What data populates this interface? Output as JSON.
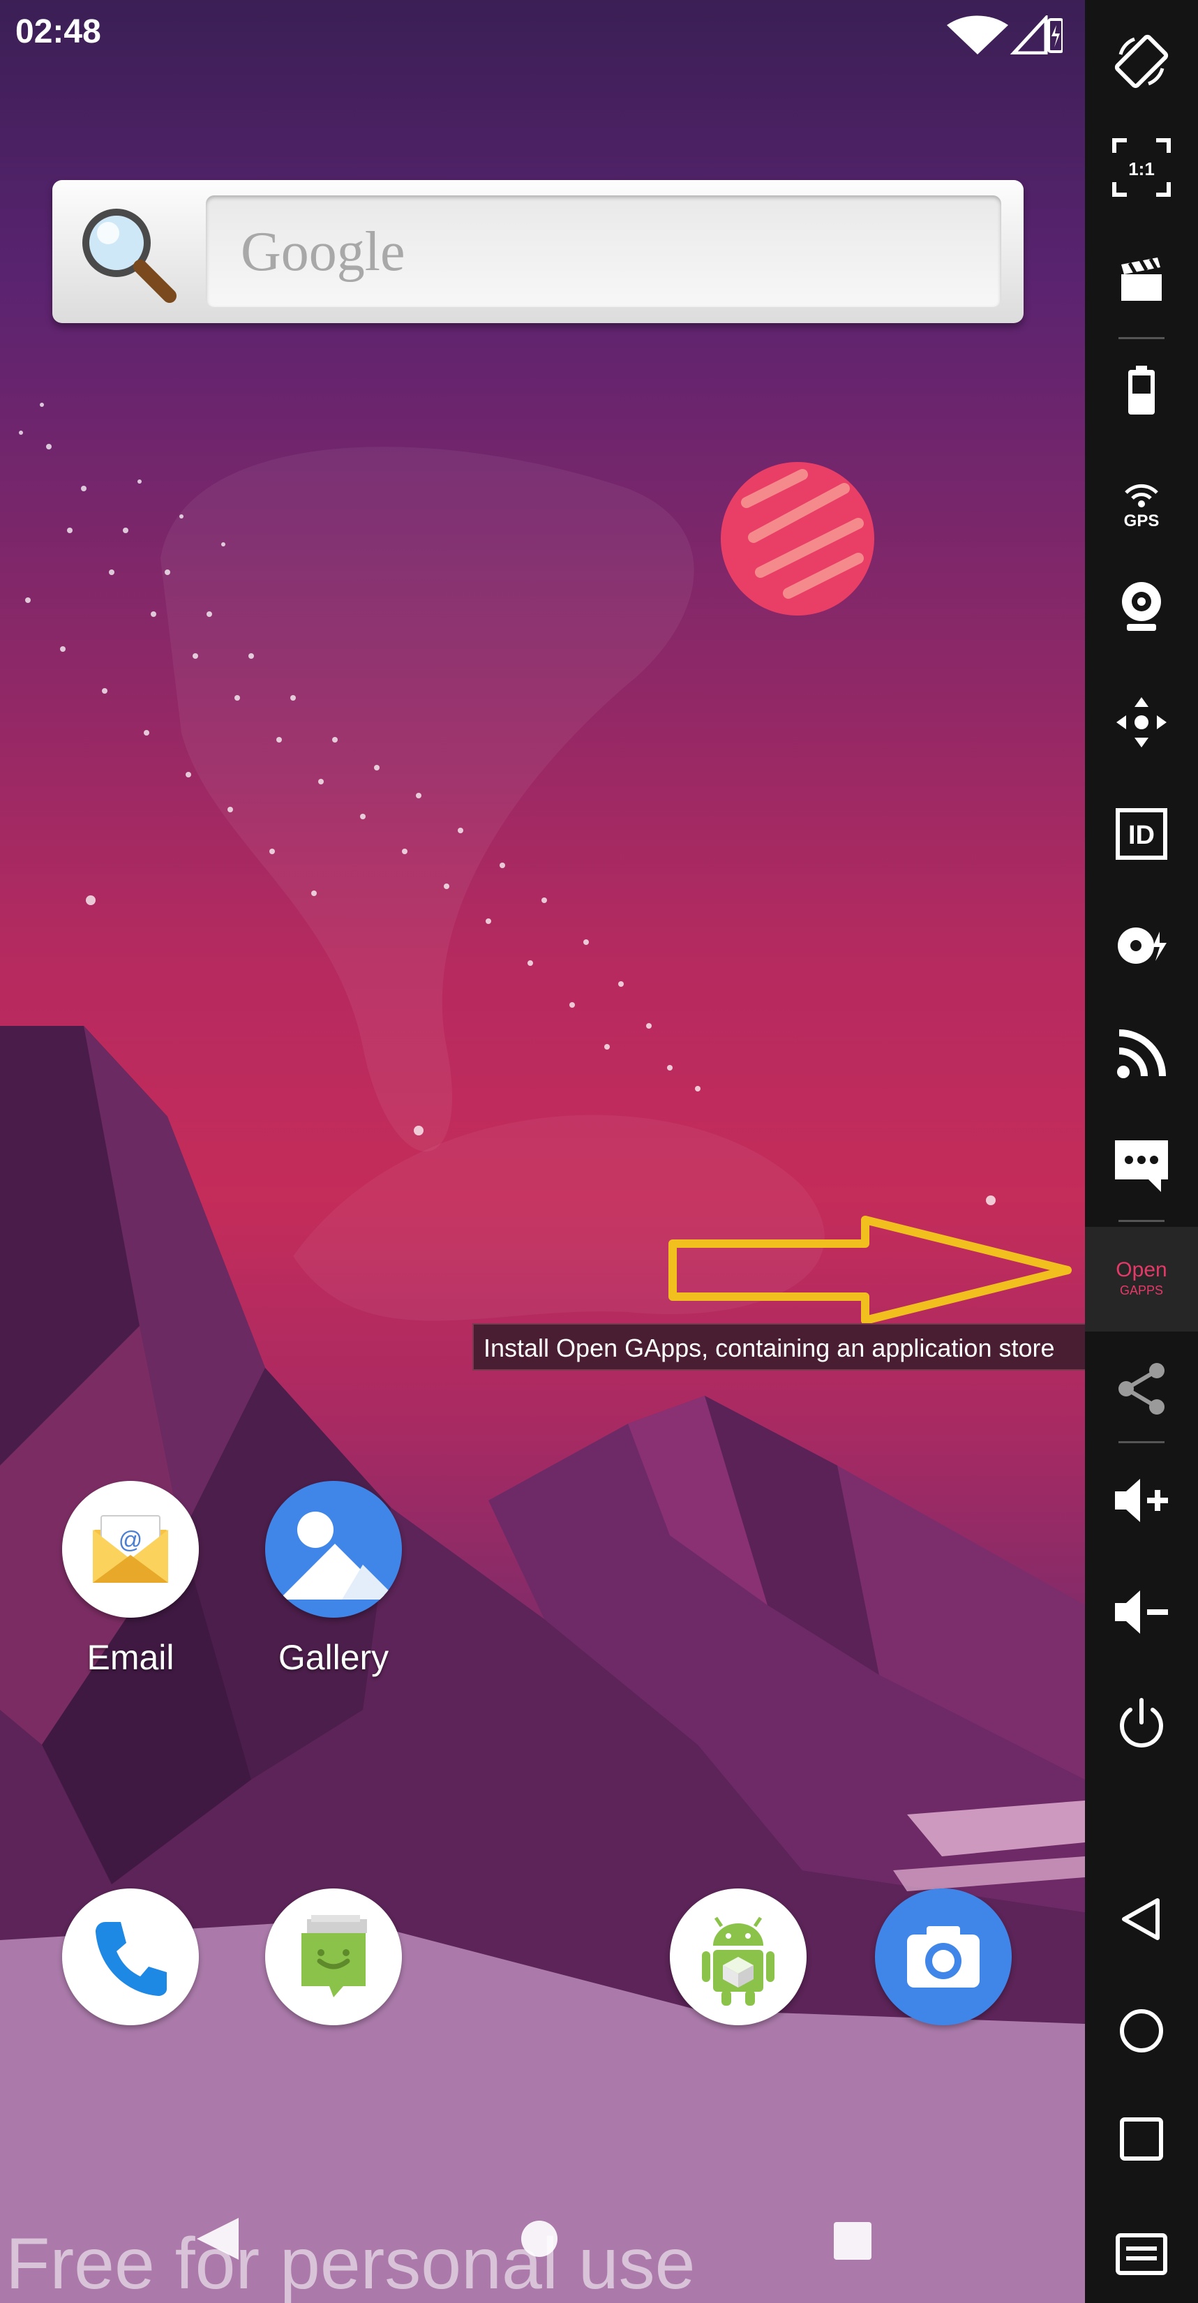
{
  "status_bar": {
    "time": "02:48"
  },
  "search_widget": {
    "placeholder": "Google"
  },
  "apps": {
    "email": {
      "label": "Email"
    },
    "gallery": {
      "label": "Gallery"
    }
  },
  "dock": [
    "phone-icon",
    "messaging-icon",
    "android-apk-icon",
    "camera-icon"
  ],
  "sidebar": {
    "items": [
      "rotate-icon",
      "pixel-perfect-icon",
      "screencast-icon",
      "battery-icon",
      "gps-icon",
      "webcam-icon",
      "remote-control-icon",
      "device-id-icon",
      "disk-io-icon",
      "network-icon",
      "sms-icon",
      "open-gapps-icon",
      "share-icon",
      "volume-up-icon",
      "volume-down-icon",
      "power-icon",
      "back-icon",
      "home-icon",
      "recent-apps-icon",
      "menu-icon"
    ],
    "gps_label": "GPS",
    "id_label": "ID",
    "pixel_label": "1:1",
    "open_gapps_label_top": "Open",
    "open_gapps_label_bottom": "GAPPS",
    "tooltip": "Install Open GApps, containing an application store"
  },
  "watermark": "Free for personal use",
  "colors": {
    "arrow": "#f2c01e",
    "accent": "#e53968",
    "sidebar_bg": "#141414"
  }
}
